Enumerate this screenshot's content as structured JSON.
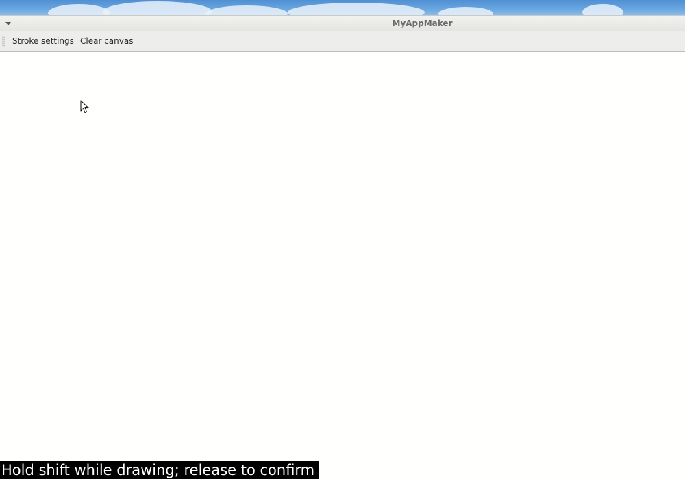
{
  "window": {
    "title": "MyAppMaker"
  },
  "toolbar": {
    "stroke_settings_label": "Stroke settings",
    "clear_canvas_label": "Clear canvas"
  },
  "caption": {
    "text": "Hold shift while drawing; release to confirm"
  },
  "icons": {
    "window_menu": "chevron-down-icon",
    "toolbar_grip": "grip-icon",
    "pointer": "mouse-pointer-icon"
  },
  "colors": {
    "canvas_background": "#fffffd",
    "toolbar_background": "#ededeb",
    "caption_background": "#000000",
    "caption_text": "#ffffff"
  }
}
